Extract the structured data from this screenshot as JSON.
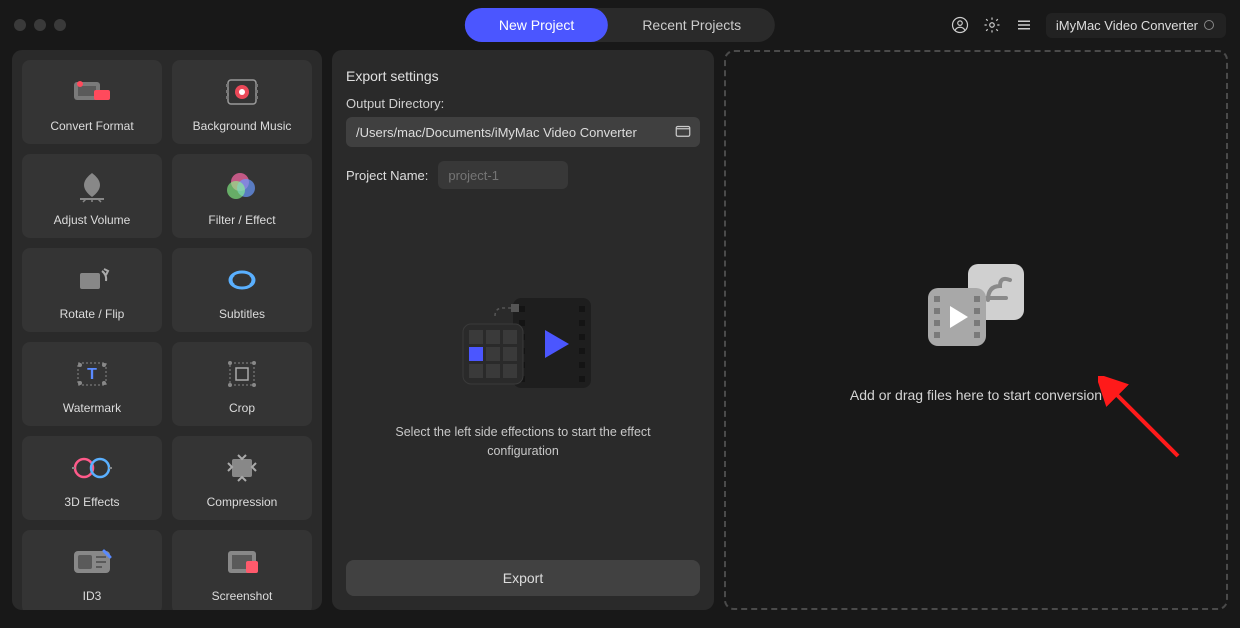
{
  "app_name": "iMyMac Video Converter",
  "tabs": {
    "new": "New Project",
    "recent": "Recent Projects"
  },
  "tools": [
    {
      "label": "Convert Format",
      "icon": "convert-format-icon"
    },
    {
      "label": "Background Music",
      "icon": "background-music-icon"
    },
    {
      "label": "Adjust Volume",
      "icon": "adjust-volume-icon"
    },
    {
      "label": "Filter / Effect",
      "icon": "filter-effect-icon"
    },
    {
      "label": "Rotate / Flip",
      "icon": "rotate-flip-icon"
    },
    {
      "label": "Subtitles",
      "icon": "subtitles-icon"
    },
    {
      "label": "Watermark",
      "icon": "watermark-icon"
    },
    {
      "label": "Crop",
      "icon": "crop-icon"
    },
    {
      "label": "3D Effects",
      "icon": "3d-effects-icon"
    },
    {
      "label": "Compression",
      "icon": "compression-icon"
    },
    {
      "label": "ID3",
      "icon": "id3-icon"
    },
    {
      "label": "Screenshot",
      "icon": "screenshot-icon"
    }
  ],
  "export": {
    "title": "Export settings",
    "output_dir_label": "Output Directory:",
    "output_dir_value": "/Users/mac/Documents/iMyMac Video Converter",
    "project_name_label": "Project Name:",
    "project_name_placeholder": "project-1",
    "hint": "Select the left side effections to start the effect configuration",
    "button": "Export"
  },
  "dropzone": {
    "text": "Add or drag files here to start conversion"
  }
}
